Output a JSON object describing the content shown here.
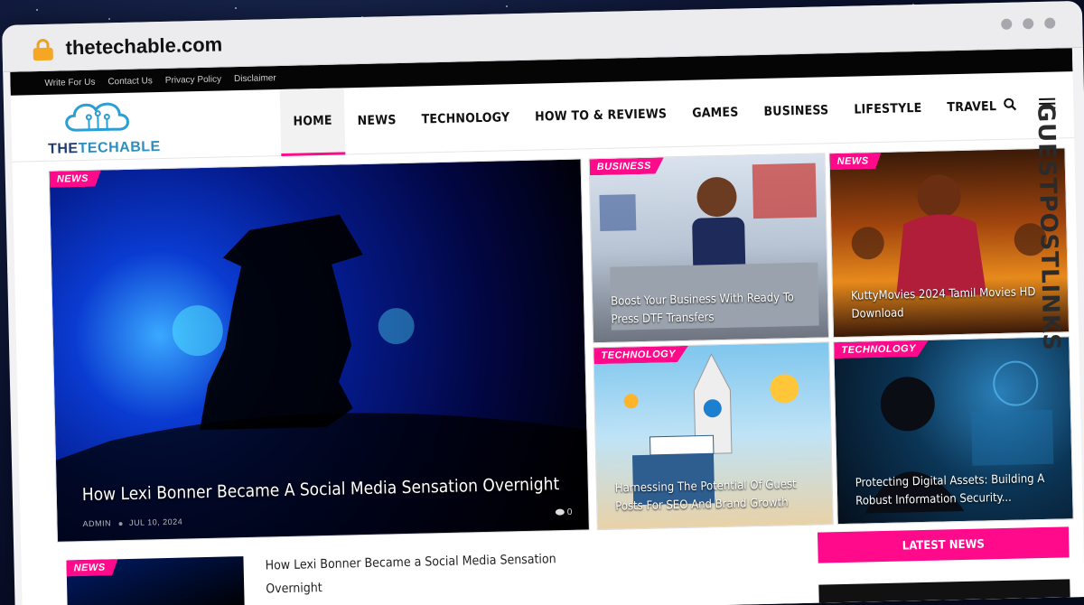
{
  "browser": {
    "url": "thetechable.com"
  },
  "topbar": {
    "links": [
      "Write For Us",
      "Contact Us",
      "Privacy Policy",
      "Disclaimer"
    ]
  },
  "logo": {
    "text_a": "THE",
    "text_b": "TECHABLE"
  },
  "nav": {
    "items": [
      "HOME",
      "NEWS",
      "TECHNOLOGY",
      "HOW TO & REVIEWS",
      "GAMES",
      "BUSINESS",
      "LIFESTYLE",
      "TRAVEL"
    ],
    "active": "HOME"
  },
  "featured": {
    "tag": "NEWS",
    "title": "How Lexi Bonner Became A Social Media Sensation Overnight",
    "author": "ADMIN",
    "date": "JUL 10, 2024",
    "comments": "0"
  },
  "tiles": [
    {
      "tag": "BUSINESS",
      "title": "Boost Your Business With Ready To Press DTF Transfers"
    },
    {
      "tag": "NEWS",
      "title": "KuttyMovies 2024 Tamil Movies HD Download"
    },
    {
      "tag": "TECHNOLOGY",
      "title": "Harnessing The Potential Of Guest Posts For SEO And Brand Growth"
    },
    {
      "tag": "TECHNOLOGY",
      "title": "Protecting Digital Assets: Building A Robust Information Security..."
    }
  ],
  "bottom": {
    "tag": "NEWS",
    "title": "How Lexi Bonner Became a Social Media Sensation Overnight",
    "latest_label": "LATEST NEWS"
  },
  "watermark": {
    "text": "GUESTPOSTLINKS"
  },
  "colors": {
    "accent": "#ff0a8a",
    "topbar": "#050505"
  }
}
